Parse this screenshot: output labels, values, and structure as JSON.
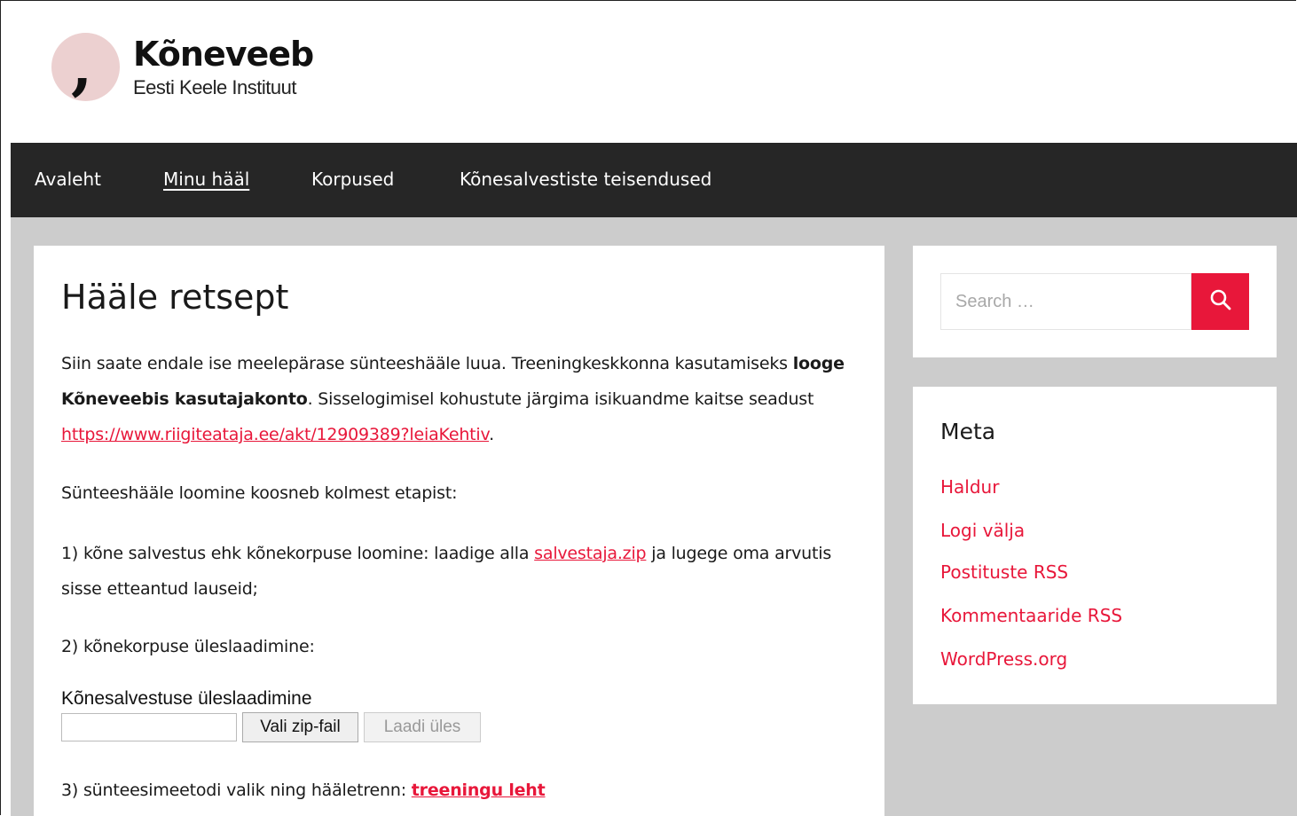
{
  "site": {
    "title": "Kõneveeb",
    "subtitle": "Eesti Keele Instituut"
  },
  "nav": {
    "items": [
      {
        "label": "Avaleht"
      },
      {
        "label": "Minu hääl"
      },
      {
        "label": "Korpused"
      },
      {
        "label": "Kõnesalvestiste teisendused"
      }
    ]
  },
  "main": {
    "title": "Hääle retsept",
    "intro": {
      "t1": "Siin saate endale ise meelepärase sünteeshääle luua. Treeningkeskkonna kasutamiseks ",
      "bold": "looge Kõneveebis kasutajakonto",
      "t2": ". Sisselogimisel kohustute järgima isikuandme kaitse seadust ",
      "link": "https://www.riigiteataja.ee/akt/12909389?leiaKehtiv",
      "t3": "."
    },
    "steps_intro": "Sünteeshääle loomine koosneb kolmest etapist:",
    "step1": {
      "t1": "1)  kõne salvestus ehk kõnekorpuse loomine: laadige alla ",
      "link": "salvestaja.zip",
      "t2": " ja lugege oma arvutis sisse etteantud lauseid;"
    },
    "step2": "2) kõnekorpuse üleslaadimine:",
    "upload": {
      "label": "Kõnesalvestuse üleslaadimine",
      "choose_label": "Vali zip-fail",
      "upload_label": "Laadi üles"
    },
    "step3": {
      "t1": "3) sünteesimeetodi valik ning hääletrenn: ",
      "link": "treeningu leht"
    }
  },
  "sidebar": {
    "search": {
      "placeholder": "Search …",
      "icon": "search-icon"
    },
    "meta": {
      "title": "Meta",
      "links": [
        {
          "label": "Haldur"
        },
        {
          "label": "Logi välja"
        },
        {
          "label": "Postituste RSS"
        },
        {
          "label": "Kommentaaride RSS"
        },
        {
          "label": "WordPress.org"
        }
      ]
    }
  },
  "colors": {
    "accent": "#e8173a",
    "nav_bg": "#262626",
    "page_bg": "#cccccc",
    "logo_circle": "#ecd0d0"
  }
}
